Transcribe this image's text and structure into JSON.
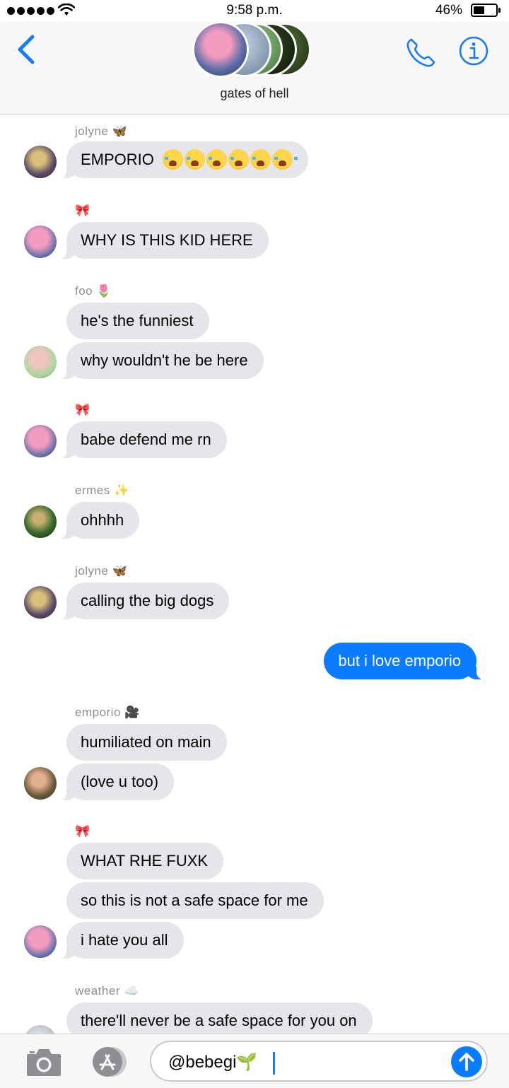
{
  "status_bar": {
    "time": "9:58 p.m.",
    "battery": "46%",
    "battery_level": 0.46
  },
  "header": {
    "group_name": "gates of hell",
    "back_icon": "chevron-left-icon",
    "call_icon": "phone-icon",
    "info_icon": "info-icon",
    "accent": "#1a7cf5"
  },
  "messages": [
    {
      "sender": "jolyne 🦋",
      "text": "EMPORIO",
      "emoji_count": 6,
      "avatar_color": "#5b4a66"
    },
    {
      "sender": "🎀",
      "text": "WHY IS THIS KID HERE",
      "avatar_color": "#e0709a"
    },
    {
      "sender": "foo 🌷",
      "text": "he's the funniest",
      "avatar_color": "#a8d89a"
    },
    {
      "text": "why wouldn't he be here"
    },
    {
      "sender": "🎀",
      "text": "babe defend me rn",
      "avatar_color": "#e0709a"
    },
    {
      "sender": "ermes ✨",
      "text": "ohhhh",
      "avatar_color": "#3d6b2e"
    },
    {
      "sender": "jolyne 🦋",
      "text": "calling the big dogs",
      "avatar_color": "#5b4a66"
    },
    {
      "text": "but i love emporio",
      "outgoing": true
    },
    {
      "sender": "emporio 🎥",
      "text": "humiliated on main",
      "avatar_color": "#6a5a3a"
    },
    {
      "text": "(love u too)"
    },
    {
      "sender": "🎀",
      "text": "WHAT RHE FUXK",
      "avatar_color": "#e0709a"
    },
    {
      "text": "so this is not a safe space for me"
    },
    {
      "text": "i hate you all"
    },
    {
      "sender": "weather ☁️",
      "text": "there'll never be a safe space for you on",
      "avatar_color": "#9aa4b0"
    }
  ],
  "composer": {
    "value": "@bebegi🌱",
    "camera_icon": "camera-icon",
    "apps_icon": "app-store-icon",
    "send_icon": "send-arrow-icon",
    "send_color": "#0a7cff"
  },
  "colors": {
    "incoming_bubble": "#e5e5ea",
    "outgoing_bubble": "#0a7cff",
    "sender_label": "#8e8e93"
  }
}
